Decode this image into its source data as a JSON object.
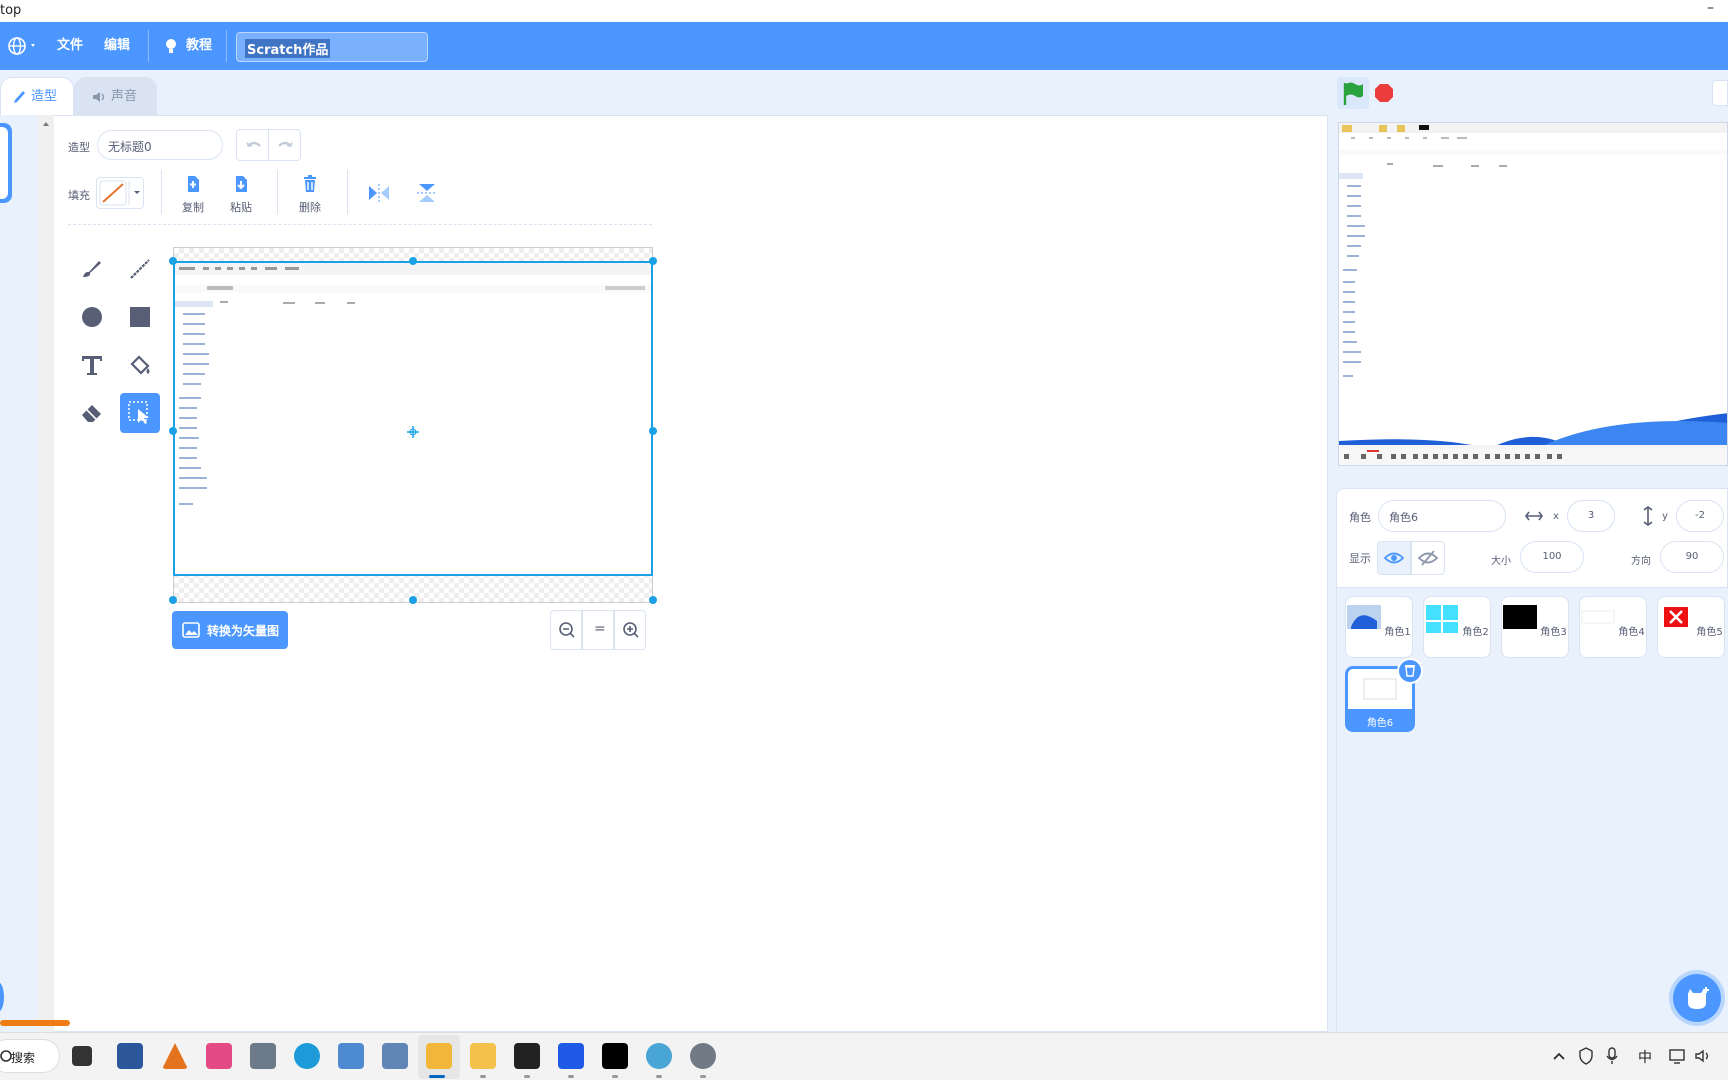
{
  "window": {
    "title_fragment": "top",
    "minimize_glyph": "–"
  },
  "menubar": {
    "file": "文件",
    "edit": "编辑",
    "tutorials": "教程",
    "project_title": "Scratch作品"
  },
  "tabs": {
    "costumes": "造型",
    "sounds": "声音"
  },
  "paint": {
    "costume_label": "造型",
    "costume_name": "无标题0",
    "fill_label": "填充",
    "copy": "复制",
    "paste": "粘贴",
    "delete": "删除",
    "convert_button": "转换为矢量图",
    "zoom_reset": "="
  },
  "sprite_info": {
    "sprite_label": "角色",
    "sprite_name": "角色6",
    "x_label": "x",
    "x_value": "3",
    "y_label": "y",
    "y_value": "-2",
    "show_label": "显示",
    "size_label": "大小",
    "size_value": "100",
    "direction_label": "方向",
    "direction_value": "90"
  },
  "sprites": [
    {
      "name": "角色1"
    },
    {
      "name": "角色2"
    },
    {
      "name": "角色3"
    },
    {
      "name": "角色4"
    },
    {
      "name": "角色5"
    },
    {
      "name": "角色6"
    }
  ],
  "taskbar": {
    "search_label": "搜索",
    "ime": "中"
  },
  "colors": {
    "menubar": "#4c97ff",
    "accent": "#4c97ff",
    "selection": "#1aa0e6",
    "stop": "#ec3d3d",
    "flag": "#2aa33f"
  }
}
